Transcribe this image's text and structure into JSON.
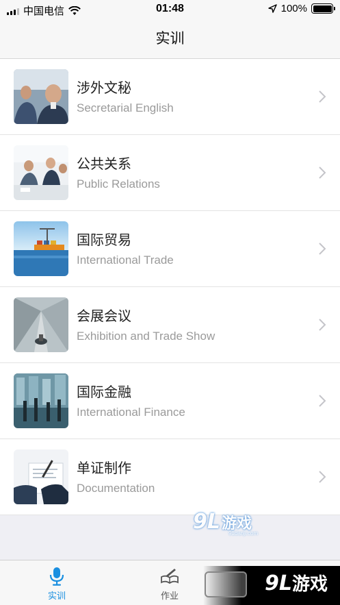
{
  "status_bar": {
    "carrier": "中国电信",
    "time": "01:48",
    "battery": "100%",
    "battery_level": 1.0
  },
  "nav": {
    "title": "实训"
  },
  "list": {
    "items": [
      {
        "title": "涉外文秘",
        "subtitle": "Secretarial English"
      },
      {
        "title": "公共关系",
        "subtitle": "Public Relations"
      },
      {
        "title": "国际贸易",
        "subtitle": "International Trade"
      },
      {
        "title": "会展会议",
        "subtitle": "Exhibition and Trade Show"
      },
      {
        "title": "国际金融",
        "subtitle": "International Finance"
      },
      {
        "title": "单证制作",
        "subtitle": "Documentation"
      }
    ]
  },
  "tab_bar": {
    "tabs": [
      {
        "label": "实训",
        "icon": "microphone-icon",
        "active": true
      },
      {
        "label": "作业",
        "icon": "book-pen-icon",
        "active": false
      }
    ],
    "active_color": "#1a8fe0"
  },
  "watermarks": {
    "middle": {
      "number": "9L",
      "text": "游戏",
      "url": "91danji.com"
    },
    "corner": {
      "number": "9L",
      "text": "游戏"
    }
  }
}
